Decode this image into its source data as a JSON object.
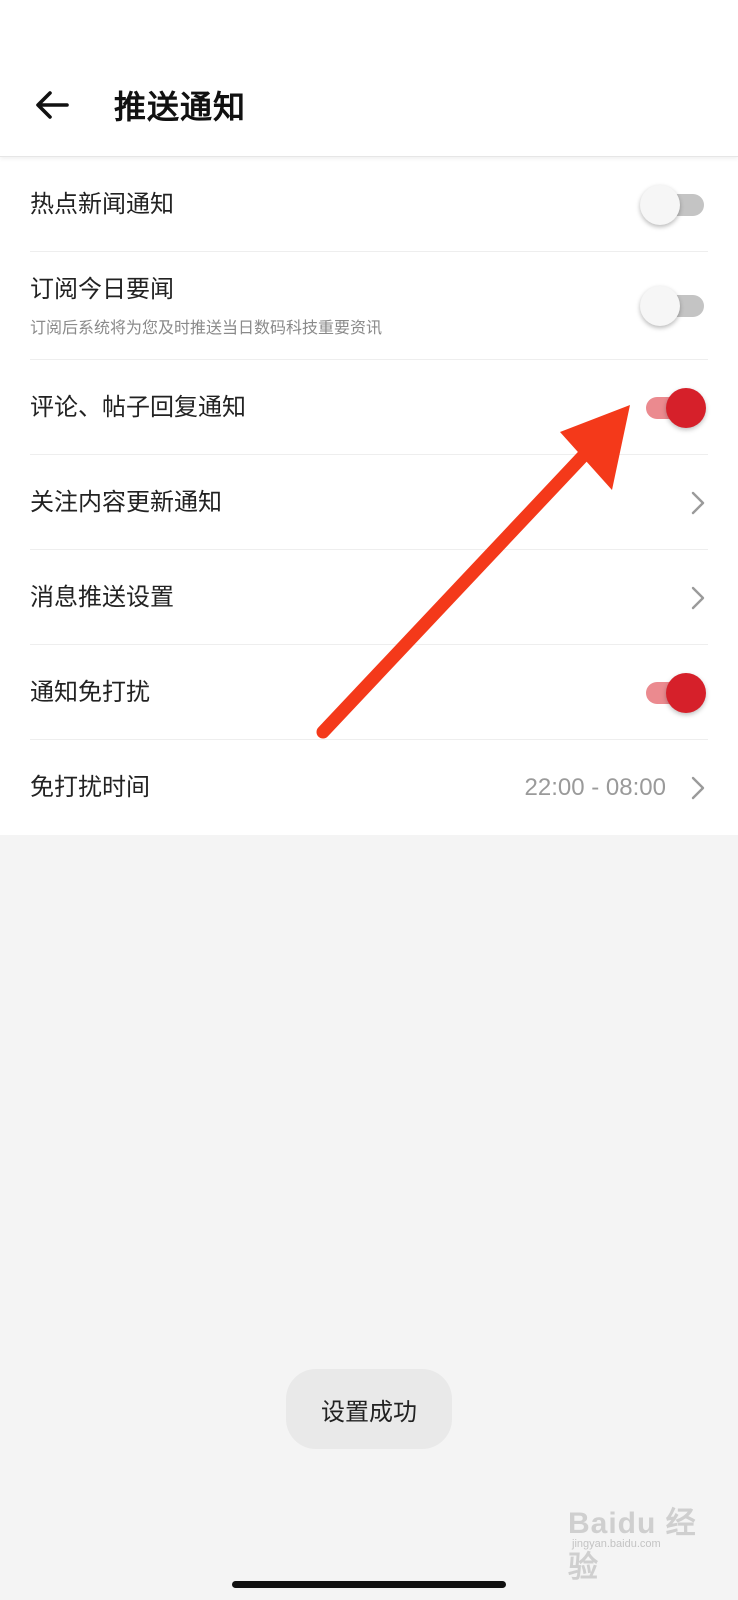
{
  "header": {
    "back_icon": "arrow-left-icon",
    "title": "推送通知"
  },
  "settings": {
    "items": [
      {
        "label": "热点新闻通知",
        "control": "toggle",
        "on": false
      },
      {
        "label": "订阅今日要闻",
        "subtitle": "订阅后系统将为您及时推送当日数码科技重要资讯",
        "control": "toggle",
        "on": false
      },
      {
        "label": "评论、帖子回复通知",
        "control": "toggle",
        "on": true
      },
      {
        "label": "关注内容更新通知",
        "control": "chevron"
      },
      {
        "label": "消息推送设置",
        "control": "chevron"
      },
      {
        "label": "通知免打扰",
        "control": "toggle",
        "on": true
      },
      {
        "label": "免打扰时间",
        "value": "22:00 - 08:00",
        "control": "chevron"
      }
    ]
  },
  "toast": {
    "text": "设置成功"
  },
  "watermark": {
    "text": "Baidu 经验",
    "sub": "jingyan.baidu.com"
  },
  "colors": {
    "toggle_on_knob": "#d6202a",
    "toggle_on_track": "#eb8a8f",
    "toggle_off_track": "#c4c4c4",
    "annotation_arrow": "#f4391a",
    "background": "#f4f4f4"
  },
  "icons": {
    "chevron": "chevron-right-icon",
    "annotation": "red-arrow-annotation-icon"
  }
}
